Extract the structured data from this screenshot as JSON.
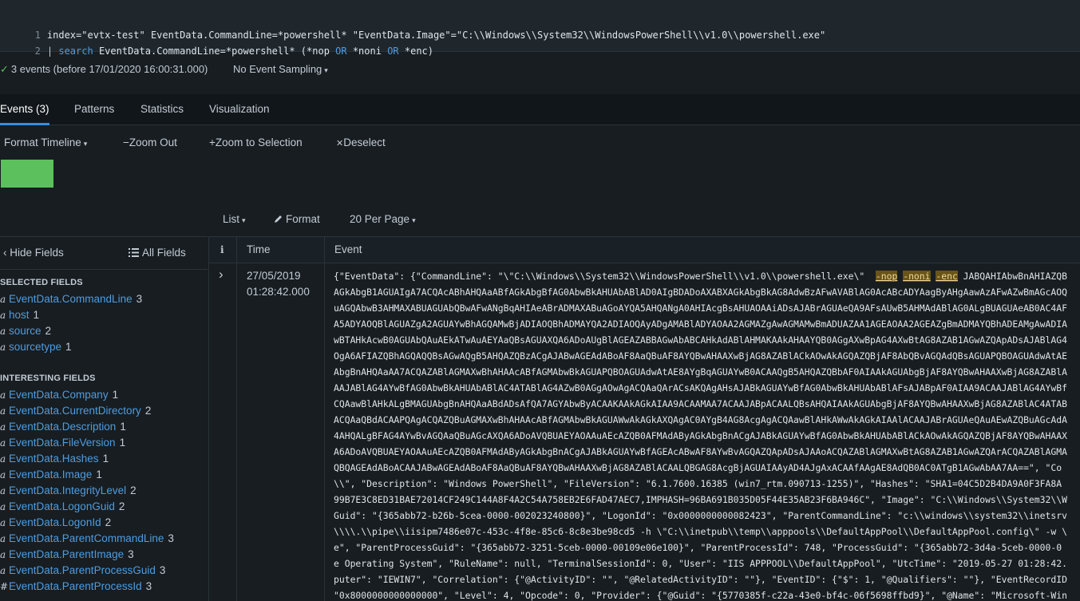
{
  "query": {
    "line1_num": "1",
    "line1": "index=\"evtx-test\" EventData.CommandLine=*powershell* \"EventData.Image\"=\"C:\\\\Windows\\\\System32\\\\WindowsPowerShell\\\\v1.0\\\\powershell.exe\"",
    "line2_num": "2",
    "line2_pipe": "| ",
    "line2_kw1": "search",
    "line2_a": " EventData.CommandLine=*powershell* (*nop ",
    "line2_or1": "OR",
    "line2_b": " *noni ",
    "line2_or2": "OR",
    "line2_c": " *enc)"
  },
  "summary": {
    "check": "✓",
    "events_text": "3 events (before 17/01/2020 16:00:31.000)",
    "sampling": "No Event Sampling"
  },
  "tabs": [
    "Events (3)",
    "Patterns",
    "Statistics",
    "Visualization"
  ],
  "timeline": {
    "format": "Format Timeline",
    "zoom_out": "Zoom Out",
    "zoom_sel": "Zoom to Selection",
    "deselect": "Deselect"
  },
  "list_toolbar": {
    "list": "List",
    "format": "Format",
    "per_page": "20 Per Page"
  },
  "sidebar": {
    "hide": "Hide Fields",
    "all": "All Fields",
    "selected_title": "SELECTED FIELDS",
    "selected": [
      {
        "type": "a",
        "name": "EventData.CommandLine",
        "count": "3"
      },
      {
        "type": "a",
        "name": "host",
        "count": "1"
      },
      {
        "type": "a",
        "name": "source",
        "count": "2"
      },
      {
        "type": "a",
        "name": "sourcetype",
        "count": "1"
      }
    ],
    "interesting_title": "INTERESTING FIELDS",
    "interesting": [
      {
        "type": "a",
        "name": "EventData.Company",
        "count": "1"
      },
      {
        "type": "a",
        "name": "EventData.CurrentDirectory",
        "count": "2"
      },
      {
        "type": "a",
        "name": "EventData.Description",
        "count": "1"
      },
      {
        "type": "a",
        "name": "EventData.FileVersion",
        "count": "1"
      },
      {
        "type": "a",
        "name": "EventData.Hashes",
        "count": "1"
      },
      {
        "type": "a",
        "name": "EventData.Image",
        "count": "1"
      },
      {
        "type": "a",
        "name": "EventData.IntegrityLevel",
        "count": "2"
      },
      {
        "type": "a",
        "name": "EventData.LogonGuid",
        "count": "2"
      },
      {
        "type": "a",
        "name": "EventData.LogonId",
        "count": "2"
      },
      {
        "type": "a",
        "name": "EventData.ParentCommandLine",
        "count": "3"
      },
      {
        "type": "a",
        "name": "EventData.ParentImage",
        "count": "3"
      },
      {
        "type": "a",
        "name": "EventData.ParentProcessGuid",
        "count": "3"
      },
      {
        "type": "#",
        "name": "EventData.ParentProcessId",
        "count": "3"
      }
    ]
  },
  "table": {
    "col_info": "i",
    "col_time": "Time",
    "col_event": "Event",
    "row": {
      "date": "27/05/2019",
      "time": "01:28:42.000",
      "line0_pre": "{\"EventData\": {\"CommandLine\": \"\\\"C:\\\\Windows\\\\System32\\\\WindowsPowerShell\\\\v1.0\\\\powershell.exe\\\"  ",
      "hl1": "-nop",
      "gap1": " ",
      "hl2": "-noni",
      "gap2": " ",
      "hl3": "-enc",
      "line0_post": " JABQAHIAbwBnAHIAZQB",
      "lines": [
        "AGkAbgB1AGUAIgA7ACQAcABhAHQAaABfAGkAbgBfAG0AbwBkAHUAbABlAD0AIgBDADoAXABXAGkAbgBkAG8AdwBzAFwAVABlAG0AcABcADYAagByAHgAawAzAFwAZwBmAGcAOQ",
        "uAGQAbwB3AHMAXABUAGUAbQBwAFwANgBqAHIAeABrADMAXABuAGoAYQA5AHQANgA0AHIAcgBsAHUAOAAiADsAJABrAGUAeQA9AFsAUwB5AHMAdABlAG0ALgBUAGUAeAB0AC4AF",
        "A5ADYAOQBlAGUAZgA2AGUAYwBhAGQAMwBjADIAOQBhADMAYQA2ADIAOQAyADgAMABlADYAOAA2AGMAZgAwAGMAMwBmADUAZAA1AGEAOAA2AGEAZgBmADMAYQBhADEAMgAwADIA",
        "wBTAHkAcwB0AGUAbQAuAEkATwAuAEYAaQBsAGUAXQA6ADoAUgBlAGEAZABBAGwAbABCAHkAdABlAHMAKAAkAHAAYQB0AGgAXwBpAG4AXwBtAG8AZAB1AGwAZQApADsAJABlAG4",
        "OgA6AFIAZQBhAGQAQQBsAGwAQgB5AHQAZQBzACgAJABwAGEAdABoAF8AaQBuAF8AYQBwAHAAXwBjAG8AZABlACkAOwAkAGQAZQBjAF8AbQBvAGQAdQBsAGUAPQBOAGUAdwAtAE",
        "AbgBnAHQAaAA7ACQAZABlAGMAXwBhAHAAcABfAGMAbwBkAGUAPQBOAGUAdwAtAE8AYgBqAGUAYwB0ACAAQgB5AHQAZQBbAF0AIAAkAGUAbgBjAF8AYQBwAHAAXwBjAG8AZABlA",
        "AAJABlAG4AYwBfAG0AbwBkAHUAbABlAC4ATABlAG4AZwB0AGgAOwAgACQAaQArACsAKQAgAHsAJABkAGUAYwBfAG0AbwBkAHUAbABlAFsAJABpAF0AIAA9ACAAJABlAG4AYwBf",
        "CQAawBlAHkALgBMAGUAbgBnAHQAaABdADsAfQA7AGYAbwByACAAKAAkAGkAIAA9ACAAMAA7ACAAJABpACAALQBsAHQAIAAkAGUAbgBjAF8AYQBwAHAAXwBjAG8AZABlAC4ATAB",
        "ACQAaQBdACAAPQAgACQAZQBuAGMAXwBhAHAAcABfAGMAbwBkAGUAWwAkAGkAXQAgAC0AYgB4AG8AcgAgACQAawBlAHkAWwAkAGkAIAAlACAAJABrAGUAeQAuAEwAZQBuAGcAdA",
        "4AHQALgBFAG4AYwBvAGQAaQBuAGcAXQA6ADoAVQBUAEYAOAAuAEcAZQB0AFMAdAByAGkAbgBnACgAJABkAGUAYwBfAG0AbwBkAHUAbABlACkAOwAkAGQAZQBjAF8AYQBwAHAAX",
        "A6ADoAVQBUAEYAOAAuAEcAZQB0AFMAdAByAGkAbgBnACgAJABkAGUAYwBfAGEAcABwAF8AYwBvAGQAZQApADsAJAAoACQAZABlAGMAXwBtAG8AZAB1AGwAZQArACQAZABlAGMA",
        "QBQAGEAdABoACAAJABwAGEAdABoAF8AaQBuAF8AYQBwAHAAXwBjAG8AZABlACAALQBGAG8AcgBjAGUAIAAyAD4AJgAxACAAfAAgAE8AdQB0AC0ATgB1AGwAbAA7AA==\", \"Co",
        "\\\\\", \"Description\": \"Windows PowerShell\", \"FileVersion\": \"6.1.7600.16385 (win7_rtm.090713-1255)\", \"Hashes\": \"SHA1=04C5D2B4DA9A0F3FA8A",
        "99B7E3C8ED31BAE72014CF249C144A8F4A2C54A758EB2E6FAD47AEC7,IMPHASH=96BA691B035D05F44E35AB23F6BA946C\", \"Image\": \"C:\\\\Windows\\\\System32\\\\W",
        "Guid\": \"{365abb72-b26b-5cea-0000-002023240800}\", \"LogonId\": \"0x0000000000082423\", \"ParentCommandLine\": \"c:\\\\windows\\\\system32\\\\inetsrv",
        "\\\\\\\\.\\\\pipe\\\\iisipm7486e07c-453c-4f8e-85c6-8c8e3be98cd5 -h \\\"C:\\\\inetpub\\\\temp\\\\apppools\\\\DefaultAppPool\\\\DefaultAppPool.config\\\" -w \\",
        "e\", \"ParentProcessGuid\": \"{365abb72-3251-5ceb-0000-00109e06e100}\", \"ParentProcessId\": 748, \"ProcessGuid\": \"{365abb72-3d4a-5ceb-0000-0",
        "e Operating System\", \"RuleName\": null, \"TerminalSessionId\": 0, \"User\": \"IIS APPPOOL\\\\DefaultAppPool\", \"UtcTime\": \"2019-05-27 01:28:42.",
        "puter\": \"IEWIN7\", \"Correlation\": {\"@ActivityID\": \"\", \"@RelatedActivityID\": \"\"}, \"EventID\": {\"$\": 1, \"@Qualifiers\": \"\"}, \"EventRecordID",
        "\"0x8000000000000000\", \"Level\": 4, \"Opcode\": 0, \"Provider\": {\"@Guid\": \"{5770385f-c22a-43e0-bf4c-06f5698ffbd9}\", \"@Name\": \"Microsoft-Win"
      ]
    }
  },
  "colors": {
    "accent": "#3a8bdb",
    "field_link": "#4f9ce0",
    "success": "#5cc05c",
    "highlight": "#6b5417"
  },
  "icons": {
    "check": "check-icon",
    "caret": "▾",
    "zoom_out": "−",
    "zoom_in": "+",
    "close": "✕",
    "chevron_left": "‹",
    "list": "list-icon",
    "pencil": "pencil-icon",
    "expand": "›"
  }
}
